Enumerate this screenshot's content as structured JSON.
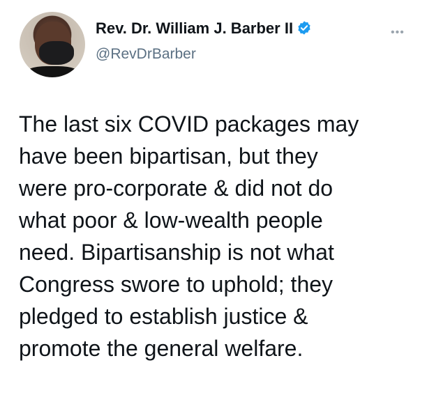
{
  "author": {
    "name": "Rev. Dr. William J. Barber II",
    "handle": "@RevDrBarber",
    "verified": true
  },
  "more_label": "•••",
  "tweet_lines": [
    "The last six COVID packages may",
    "have been bipartisan, but they",
    "were pro-corporate & did not do",
    "what poor & low-wealth people",
    "need. Bipartisanship is not what",
    "Congress swore to uphold; they",
    "pledged to establish justice &",
    "promote the general welfare."
  ],
  "colors": {
    "verified": "#1d9bf0",
    "handle": "#5b7083"
  }
}
